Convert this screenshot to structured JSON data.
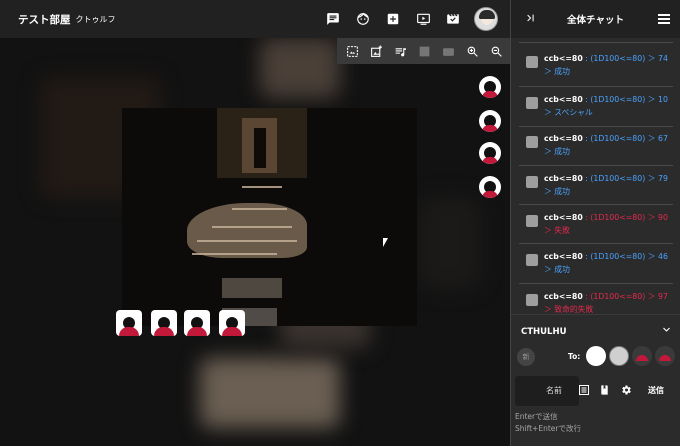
{
  "header": {
    "room_name": "テスト部屋",
    "system_name": "クトゥルフ",
    "icons": [
      "chat-icon",
      "face-icon",
      "add-box-icon",
      "video-icon",
      "movie-edit-icon"
    ]
  },
  "stage_toolbar": {
    "icons": [
      "image-select-icon",
      "image-add-icon",
      "playlist-music-icon",
      "screen-icon",
      "camera-icon",
      "zoom-in-icon",
      "zoom-out-icon"
    ]
  },
  "panel": {
    "title": "全体チャット",
    "messages": [
      {
        "cmd": "ccb<=80",
        "res": " : (1D100<=80) ＞ 74 ＞ 成功",
        "status": "ok"
      },
      {
        "cmd": "ccb<=80",
        "res": " : (1D100<=80) ＞ 10 ＞ スペシャル",
        "status": "ok"
      },
      {
        "cmd": "ccb<=80",
        "res": " : (1D100<=80) ＞ 67 ＞ 成功",
        "status": "ok"
      },
      {
        "cmd": "ccb<=80",
        "res": " : (1D100<=80) ＞ 79 ＞ 成功",
        "status": "ok"
      },
      {
        "cmd": "ccb<=80",
        "res": " : (1D100<=80) ＞ 90 ＞ 失敗",
        "status": "ng"
      },
      {
        "cmd": "ccb<=80",
        "res": " : (1D100<=80) ＞ 46 ＞ 成功",
        "status": "ok"
      },
      {
        "cmd": "ccb<=80",
        "res": " : (1D100<=80) ＞ 97 ＞ 致命的失敗",
        "status": "ng"
      }
    ]
  },
  "composer": {
    "tab": "CTHULHU",
    "char_avatar_text": "新",
    "to_label": "To:",
    "name_label": "名前",
    "send_label": "送信",
    "hint_enter": "Enterで送信",
    "hint_shift": "Shift+Enterで改行"
  },
  "colors": {
    "success": "#4aa3ff",
    "failure": "#e52a4e",
    "piece_mouth": "#c2183a"
  }
}
